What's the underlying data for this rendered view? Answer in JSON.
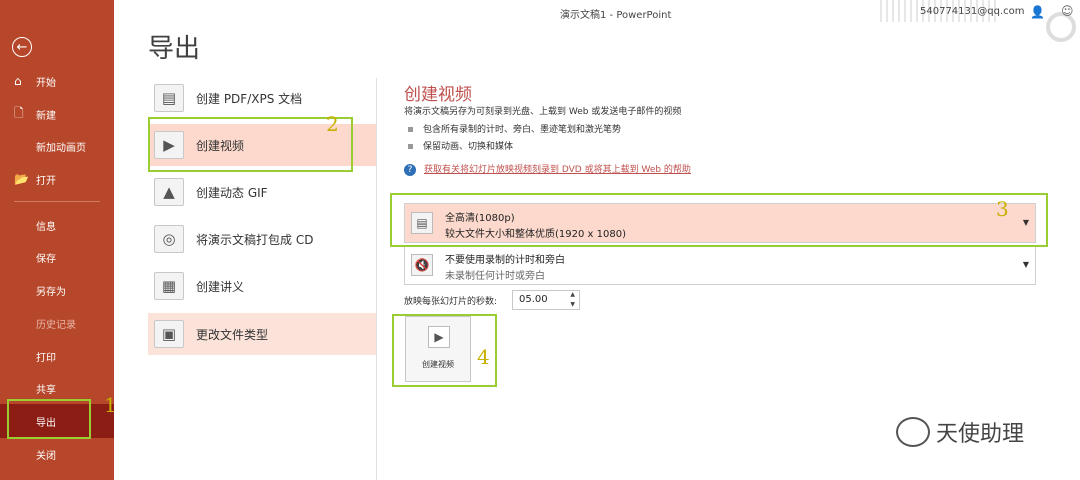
{
  "window": {
    "title": "演示文稿1  -  PowerPoint",
    "account": "540774131@qq.com"
  },
  "sidebar": {
    "items": [
      {
        "label": "开始",
        "icon": "home-icon"
      },
      {
        "label": "新建",
        "icon": "new-file-icon"
      },
      {
        "label": "新加动画页"
      },
      {
        "label": "打开",
        "icon": "folder-open-icon"
      },
      {
        "label": "信息"
      },
      {
        "label": "保存"
      },
      {
        "label": "另存为"
      },
      {
        "label": "历史记录",
        "disabled": true
      },
      {
        "label": "打印"
      },
      {
        "label": "共享"
      },
      {
        "label": "导出",
        "active": true
      },
      {
        "label": "关闭"
      }
    ]
  },
  "page": {
    "title": "导出"
  },
  "options": [
    {
      "label": "创建 PDF/XPS 文档",
      "icon": "pdf-document-icon"
    },
    {
      "label": "创建视频",
      "icon": "video-icon",
      "selected": true
    },
    {
      "label": "创建动态 GIF",
      "icon": "gif-icon"
    },
    {
      "label": "将演示文稿打包成 CD",
      "icon": "cd-icon"
    },
    {
      "label": "创建讲义",
      "icon": "handout-icon"
    },
    {
      "label": "更改文件类型",
      "icon": "change-file-type-icon"
    }
  ],
  "detail": {
    "title": "创建视频",
    "description": "将演示文稿另存为可刻录到光盘、上载到 Web 或发送电子邮件的视频",
    "bullets": [
      "包含所有录制的计时、旁白、墨迹笔划和激光笔势",
      "保留动画、切换和媒体"
    ],
    "help_link": "获取有关将幻灯片放映视频刻录到 DVD 或将其上载到 Web 的帮助",
    "quality": {
      "title": "全高清(1080p)",
      "subtitle": "较大文件大小和整体优质(1920 x 1080)"
    },
    "timing": {
      "title": "不要使用录制的计时和旁白",
      "subtitle": "未录制任何计时或旁白"
    },
    "seconds_label": "放映每张幻灯片的秒数:",
    "seconds_value": "05.00",
    "create_button": "创建视频"
  },
  "annotations": [
    "1",
    "2",
    "3",
    "4"
  ],
  "watermark": "天使助理",
  "colors": {
    "sidebar": "#b7472a",
    "active": "#8c1d15",
    "selected_bg": "#fcd9cc",
    "accent_title": "#c0504d",
    "highlight": "#9acd32"
  }
}
